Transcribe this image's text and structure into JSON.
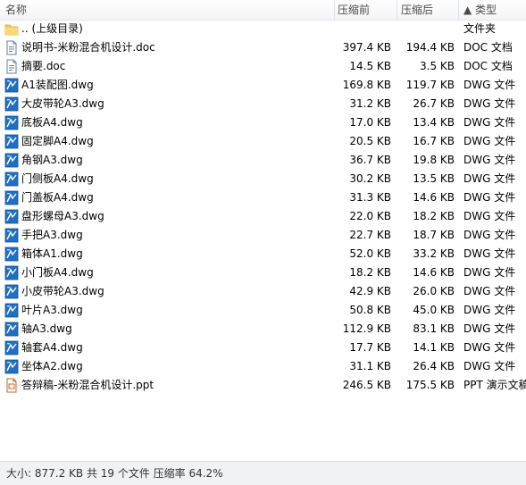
{
  "columns": {
    "name": "名称",
    "size": "压缩前",
    "packed": "压缩后",
    "type": "▲ 类型"
  },
  "files": [
    {
      "name": ".. (上级目录)",
      "size": "",
      "packed": "",
      "type": "文件夹",
      "icon": "folder-up-icon"
    },
    {
      "name": "说明书-米粉混合机设计.doc",
      "size": "397.4 KB",
      "packed": "194.4 KB",
      "type": "DOC 文档",
      "icon": "doc-file-icon"
    },
    {
      "name": "摘要.doc",
      "size": "14.5 KB",
      "packed": "3.5 KB",
      "type": "DOC 文档",
      "icon": "doc-file-icon"
    },
    {
      "name": "A1装配图.dwg",
      "size": "169.8 KB",
      "packed": "119.7 KB",
      "type": "DWG 文件",
      "icon": "dwg-file-icon"
    },
    {
      "name": "大皮带轮A3.dwg",
      "size": "31.2 KB",
      "packed": "26.7 KB",
      "type": "DWG 文件",
      "icon": "dwg-file-icon"
    },
    {
      "name": "底板A4.dwg",
      "size": "17.0 KB",
      "packed": "13.4 KB",
      "type": "DWG 文件",
      "icon": "dwg-file-icon"
    },
    {
      "name": "固定脚A4.dwg",
      "size": "20.5 KB",
      "packed": "16.7 KB",
      "type": "DWG 文件",
      "icon": "dwg-file-icon"
    },
    {
      "name": "角钢A3.dwg",
      "size": "36.7 KB",
      "packed": "19.8 KB",
      "type": "DWG 文件",
      "icon": "dwg-file-icon"
    },
    {
      "name": "门侧板A4.dwg",
      "size": "30.2 KB",
      "packed": "13.5 KB",
      "type": "DWG 文件",
      "icon": "dwg-file-icon"
    },
    {
      "name": "门盖板A4.dwg",
      "size": "31.3 KB",
      "packed": "14.6 KB",
      "type": "DWG 文件",
      "icon": "dwg-file-icon"
    },
    {
      "name": "盘形螺母A3.dwg",
      "size": "22.0 KB",
      "packed": "18.2 KB",
      "type": "DWG 文件",
      "icon": "dwg-file-icon"
    },
    {
      "name": "手把A3.dwg",
      "size": "22.7 KB",
      "packed": "18.7 KB",
      "type": "DWG 文件",
      "icon": "dwg-file-icon"
    },
    {
      "name": "箱体A1.dwg",
      "size": "52.0 KB",
      "packed": "33.2 KB",
      "type": "DWG 文件",
      "icon": "dwg-file-icon"
    },
    {
      "name": "小门板A4.dwg",
      "size": "18.2 KB",
      "packed": "14.6 KB",
      "type": "DWG 文件",
      "icon": "dwg-file-icon"
    },
    {
      "name": "小皮带轮A3.dwg",
      "size": "42.9 KB",
      "packed": "26.0 KB",
      "type": "DWG 文件",
      "icon": "dwg-file-icon"
    },
    {
      "name": "叶片A3.dwg",
      "size": "50.8 KB",
      "packed": "45.0 KB",
      "type": "DWG 文件",
      "icon": "dwg-file-icon"
    },
    {
      "name": "轴A3.dwg",
      "size": "112.9 KB",
      "packed": "83.1 KB",
      "type": "DWG 文件",
      "icon": "dwg-file-icon"
    },
    {
      "name": "轴套A4.dwg",
      "size": "17.7 KB",
      "packed": "14.1 KB",
      "type": "DWG 文件",
      "icon": "dwg-file-icon"
    },
    {
      "name": "坐体A2.dwg",
      "size": "31.1 KB",
      "packed": "26.4 KB",
      "type": "DWG 文件",
      "icon": "dwg-file-icon"
    },
    {
      "name": "答辩稿-米粉混合机设计.ppt",
      "size": "246.5 KB",
      "packed": "175.5 KB",
      "type": "PPT 演示文稿",
      "icon": "ppt-file-icon"
    }
  ],
  "status": {
    "text": "大小: 877.2 KB 共 19 个文件 压缩率 64.2%"
  },
  "colors": {
    "folder": "#f3c94d",
    "dwg": "#1f6fc5",
    "doc": "#6a7f9a",
    "ppt": "#c8602a"
  }
}
